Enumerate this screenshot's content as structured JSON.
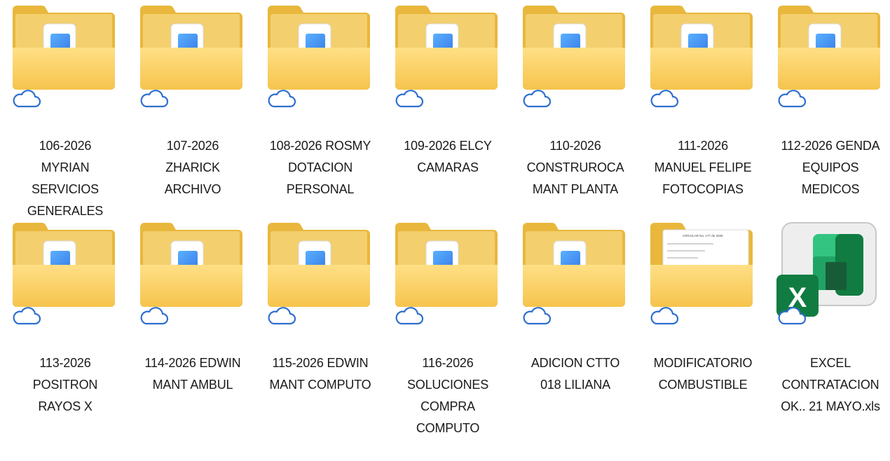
{
  "items": [
    {
      "type": "folder",
      "lines": [
        "106-2026",
        "MYRIAN",
        "SERVICIOS",
        "GENERALES"
      ],
      "status_icon": "cloud-icon"
    },
    {
      "type": "folder",
      "lines": [
        "107-2026",
        "ZHARICK",
        "ARCHIVO"
      ],
      "status_icon": "cloud-icon"
    },
    {
      "type": "folder",
      "lines": [
        "108-2026 ROSMY",
        "DOTACION",
        "PERSONAL"
      ],
      "status_icon": "cloud-icon"
    },
    {
      "type": "folder",
      "lines": [
        "109-2026 ELCY",
        "CAMARAS"
      ],
      "status_icon": "cloud-icon"
    },
    {
      "type": "folder",
      "lines": [
        "110-2026",
        "CONSTRUROCA",
        "MANT PLANTA"
      ],
      "status_icon": "cloud-icon"
    },
    {
      "type": "folder",
      "lines": [
        "111-2026",
        "MANUEL FELIPE",
        "FOTOCOPIAS"
      ],
      "status_icon": "cloud-icon"
    },
    {
      "type": "folder",
      "lines": [
        "112-2026 GENDA",
        "EQUIPOS",
        "MEDICOS"
      ],
      "status_icon": "cloud-icon"
    },
    {
      "type": "folder",
      "lines": [
        "113-2026",
        "POSITRON",
        "RAYOS X"
      ],
      "status_icon": "cloud-icon"
    },
    {
      "type": "folder",
      "lines": [
        "114-2026 EDWIN",
        "MANT AMBUL"
      ],
      "status_icon": "cloud-icon"
    },
    {
      "type": "folder",
      "lines": [
        "115-2026 EDWIN",
        "MANT COMPUTO"
      ],
      "status_icon": "cloud-icon"
    },
    {
      "type": "folder",
      "lines": [
        "116-2026",
        "SOLUCIONES",
        "COMPRA",
        "COMPUTO"
      ],
      "status_icon": "cloud-icon"
    },
    {
      "type": "folder",
      "lines": [
        "ADICION CTTO",
        "018 LILIANA"
      ],
      "status_icon": "cloud-icon"
    },
    {
      "type": "folder-doc",
      "lines": [
        "MODIFICATORIO",
        "COMBUSTIBLE"
      ],
      "status_icon": "cloud-icon"
    },
    {
      "type": "excel",
      "lines": [
        "EXCEL",
        "CONTRATACION",
        "OK..  21 MAYO.xls"
      ],
      "status_icon": "cloud-icon"
    }
  ],
  "colors": {
    "folder_back": "#e9b73c",
    "folder_front": "#fdd870",
    "cloud": "#2f6fce",
    "excel_dark": "#107c41"
  }
}
